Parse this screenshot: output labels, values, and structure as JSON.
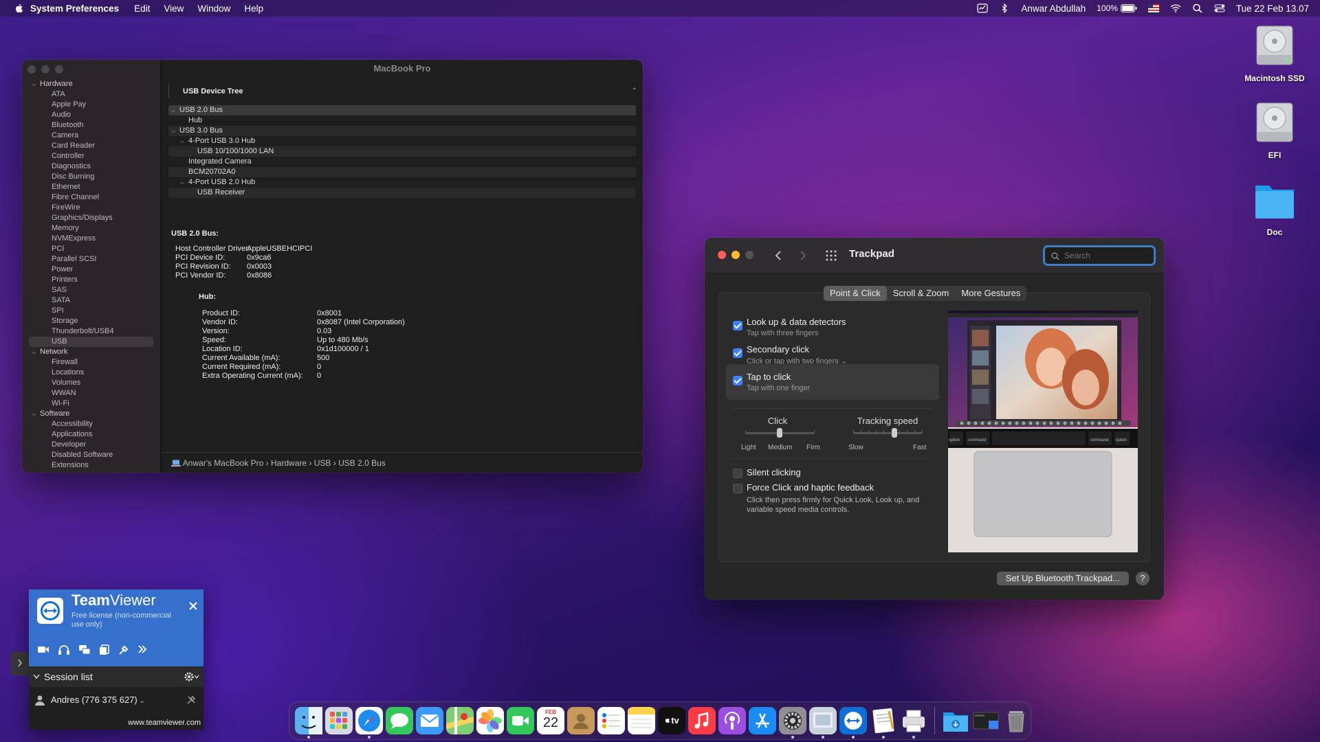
{
  "menubar": {
    "app": "System Preferences",
    "items": [
      "Edit",
      "View",
      "Window",
      "Help"
    ],
    "user": "Anwar Abdullah",
    "battery": "100%",
    "datetime": "Tue 22 Feb  13.07"
  },
  "desktop": {
    "icons": [
      "Macintosh SSD",
      "EFI",
      "Doc"
    ]
  },
  "sysinfo": {
    "title": "MacBook Pro",
    "sidebar": [
      {
        "g": "Hardware"
      },
      {
        "i": "ATA"
      },
      {
        "i": "Apple Pay"
      },
      {
        "i": "Audio"
      },
      {
        "i": "Bluetooth"
      },
      {
        "i": "Camera"
      },
      {
        "i": "Card Reader"
      },
      {
        "i": "Controller"
      },
      {
        "i": "Diagnostics"
      },
      {
        "i": "Disc Burning"
      },
      {
        "i": "Ethernet"
      },
      {
        "i": "Fibre Channel"
      },
      {
        "i": "FireWire"
      },
      {
        "i": "Graphics/Displays"
      },
      {
        "i": "Memory"
      },
      {
        "i": "NVMExpress"
      },
      {
        "i": "PCI"
      },
      {
        "i": "Parallel SCSI"
      },
      {
        "i": "Power"
      },
      {
        "i": "Printers"
      },
      {
        "i": "SAS"
      },
      {
        "i": "SATA"
      },
      {
        "i": "SPI"
      },
      {
        "i": "Storage"
      },
      {
        "i": "Thunderbolt/USB4"
      },
      {
        "i": "USB",
        "sel": true
      },
      {
        "g": "Network"
      },
      {
        "i": "Firewall"
      },
      {
        "i": "Locations"
      },
      {
        "i": "Volumes"
      },
      {
        "i": "WWAN"
      },
      {
        "i": "Wi-Fi"
      },
      {
        "g": "Software"
      },
      {
        "i": "Accessibility"
      },
      {
        "i": "Applications"
      },
      {
        "i": "Developer"
      },
      {
        "i": "Disabled Software"
      },
      {
        "i": "Extensions"
      }
    ],
    "tree_header": "USB Device Tree",
    "tree": [
      {
        "t": "USB 2.0 Bus",
        "lvl": 0,
        "chev": true,
        "sel": true
      },
      {
        "t": "Hub",
        "lvl": 1,
        "chev": false
      },
      {
        "t": "USB 3.0 Bus",
        "lvl": 0,
        "chev": true
      },
      {
        "t": "4-Port USB 3.0 Hub",
        "lvl": 1,
        "chev": true
      },
      {
        "t": "USB 10/100/1000 LAN",
        "lvl": 2,
        "chev": false
      },
      {
        "t": "Integrated Camera",
        "lvl": 1,
        "chev": false
      },
      {
        "t": "BCM20702A0",
        "lvl": 1,
        "chev": false
      },
      {
        "t": "4-Port USB 2.0 Hub",
        "lvl": 1,
        "chev": true
      },
      {
        "t": "USB Receiver",
        "lvl": 2,
        "chev": false
      },
      {
        "t": "",
        "lvl": 0,
        "chev": false
      }
    ],
    "detail": {
      "heading": "USB 2.0 Bus:",
      "bus": [
        [
          "Host Controller Driver:",
          "AppleUSBEHCIPCI"
        ],
        [
          "PCI Device ID:",
          "0x9ca6"
        ],
        [
          "PCI Revision ID:",
          "0x0003"
        ],
        [
          "PCI Vendor ID:",
          "0x8086"
        ]
      ],
      "hub_heading": "Hub:",
      "hub": [
        [
          "Product ID:",
          "0x8001"
        ],
        [
          "Vendor ID:",
          "0x8087  (Intel Corporation)"
        ],
        [
          "Version:",
          "0.03"
        ],
        [
          "Speed:",
          "Up to 480 Mb/s"
        ],
        [
          "Location ID:",
          "0x1d100000 / 1"
        ],
        [
          "Current Available (mA):",
          "500"
        ],
        [
          "Current Required (mA):",
          "0"
        ],
        [
          "Extra Operating Current (mA):",
          "0"
        ]
      ]
    },
    "path": [
      "Anwar's MacBook Pro",
      "Hardware",
      "USB",
      "USB 2.0 Bus"
    ]
  },
  "trackpad": {
    "title": "Trackpad",
    "search_placeholder": "Search",
    "tabs": [
      "Point & Click",
      "Scroll & Zoom",
      "More Gestures"
    ],
    "options": [
      {
        "label": "Look up & data detectors",
        "sub": "Tap with three fingers",
        "checked": true
      },
      {
        "label": "Secondary click",
        "sub": "Click or tap with two fingers ⌄",
        "checked": true
      },
      {
        "label": "Tap to click",
        "sub": "Tap with one finger",
        "checked": true
      }
    ],
    "click": {
      "label": "Click",
      "min": "Light",
      "mid": "Medium",
      "max": "Firm",
      "value": 0.5
    },
    "tracking": {
      "label": "Tracking speed",
      "min": "Slow",
      "max": "Fast",
      "value": 0.6
    },
    "silent": {
      "label": "Silent clicking",
      "checked": false
    },
    "force": {
      "label": "Force Click and haptic feedback",
      "checked": false,
      "desc": "Click then press firmly for Quick Look, Look up, and variable speed media controls."
    },
    "setup_button": "Set Up Bluetooth Trackpad...",
    "help": "?",
    "keys": [
      "option",
      "command",
      "command",
      "option"
    ]
  },
  "teamviewer": {
    "brand1": "Team",
    "brand2": "Viewer",
    "license": "Free license (non-commercial use only)",
    "session_list": "Session list",
    "contact": "Andres (776 375 627)",
    "url": "www.teamviewer.com"
  },
  "dock": {
    "calendar_month": "FEB",
    "calendar_day": "22",
    "tv_label": "tv"
  },
  "colors": {
    "accent": "#3a82f7",
    "tv_blue": "#3470cc",
    "red": "#ff5f57",
    "yellow": "#febc2e",
    "green": "#28c840"
  }
}
